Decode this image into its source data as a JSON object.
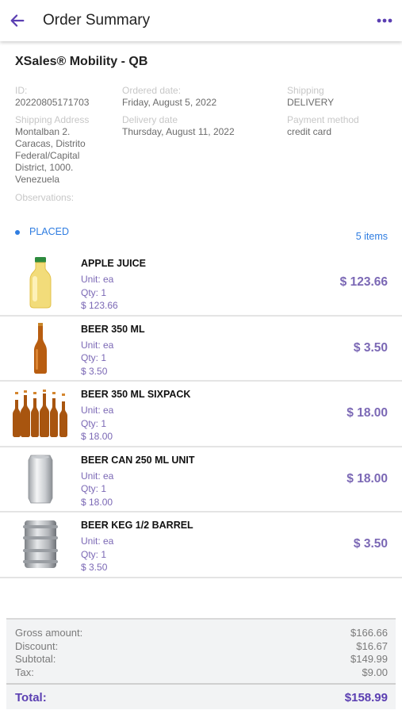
{
  "header": {
    "title": "Order Summary",
    "back_icon": "arrow-left-icon",
    "more_icon": "more-horizontal-icon"
  },
  "company": "XSales® Mobility - QB",
  "info": {
    "id_label": "ID:",
    "id_value": "20220805171703",
    "ordered_label": "Ordered date:",
    "ordered_value": "Friday, August 5, 2022",
    "shipping_label": "Shipping",
    "shipping_value": "DELIVERY",
    "address_label": "Shipping Address",
    "address_lines": [
      "Montalban 2.",
      "Caracas, Distrito",
      "Federal/Capital",
      "District, 1000.",
      "Venezuela"
    ],
    "delivery_label": "Delivery date",
    "delivery_value": "Thursday, August 11, 2022",
    "payment_label": "Payment method",
    "payment_value": "credit card",
    "observations_label": "Observations:"
  },
  "status": {
    "label": "PLACED",
    "items_count": "5 items",
    "color": "#2f7de1"
  },
  "items": [
    {
      "name": "APPLE JUICE",
      "unit": "Unit: ea",
      "qty": "Qty: 1",
      "line_total": "$ 123.66",
      "price": "$ 123.66",
      "image": "apple-juice-bottle-icon"
    },
    {
      "name": "BEER 350 ML",
      "unit": "Unit: ea",
      "qty": "Qty: 1",
      "line_total": "$ 3.50",
      "price": "$ 3.50",
      "image": "beer-bottle-icon"
    },
    {
      "name": "BEER 350 ML SIXPACK",
      "unit": "Unit: ea",
      "qty": "Qty: 1",
      "line_total": "$ 18.00",
      "price": "$ 18.00",
      "image": "beer-sixpack-icon"
    },
    {
      "name": "BEER CAN 250 ML UNIT",
      "unit": "Unit: ea",
      "qty": "Qty: 1",
      "line_total": "$ 18.00",
      "price": "$ 18.00",
      "image": "beer-can-icon"
    },
    {
      "name": "BEER KEG 1/2 BARREL",
      "unit": "Unit: ea",
      "qty": "Qty: 1",
      "line_total": "$ 3.50",
      "price": "$ 3.50",
      "image": "beer-keg-icon"
    }
  ],
  "totals": {
    "gross_label": "Gross amount:",
    "gross_value": "$166.66",
    "discount_label": "Discount:",
    "discount_value": "$16.67",
    "subtotal_label": "Subtotal:",
    "subtotal_value": "$149.99",
    "tax_label": "Tax:",
    "tax_value": "$9.00",
    "total_label": "Total:",
    "total_value": "$158.99"
  },
  "colors": {
    "accent": "#5b3fb2",
    "price": "#7b68b5",
    "link": "#2f7de1"
  }
}
